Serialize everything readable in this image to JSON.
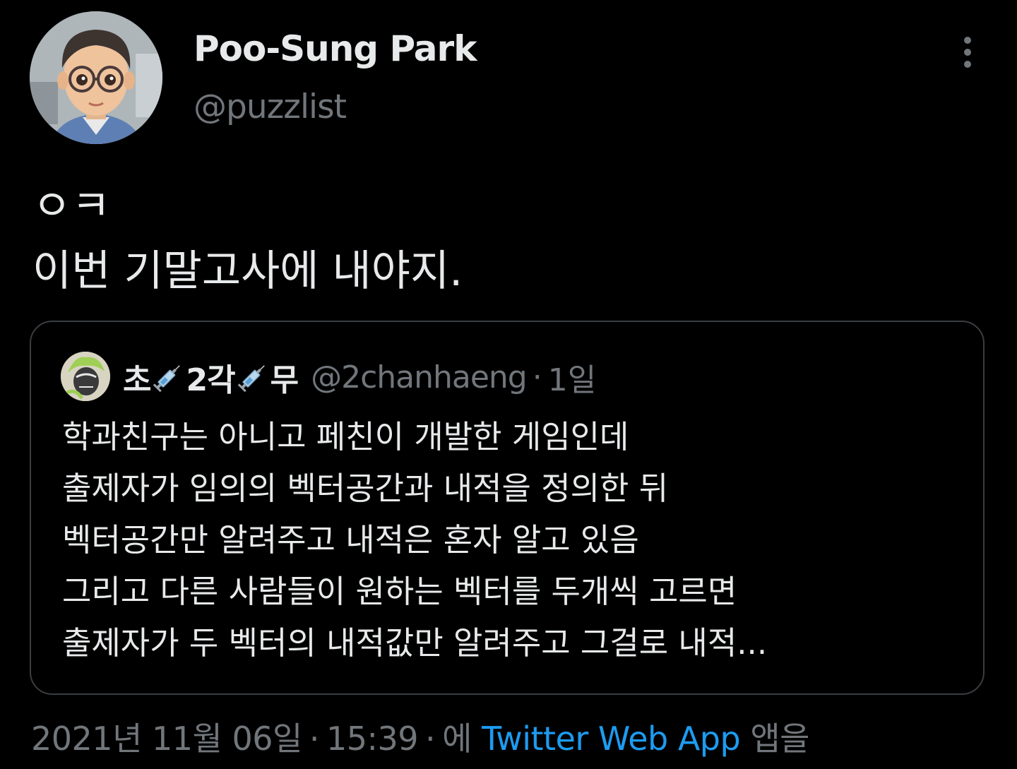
{
  "tweet": {
    "author": {
      "name": "Poo-Sung Park",
      "handle": "@puzzlist",
      "avatar": "avatar-icon"
    },
    "more_icon": "more-vertical-icon",
    "text_lines": [
      "ㅇㅋ",
      "이번 기말고사에 내야지."
    ],
    "quote": {
      "name_parts": [
        "초",
        "2각",
        "무"
      ],
      "name_emoji": "syringe-icon",
      "handle": "@2chanhaeng",
      "separator": "·",
      "time": "1일",
      "text_lines": [
        "학과친구는 아니고 페친이 개발한 게임인데",
        "출제자가 임의의 벡터공간과 내적을 정의한 뒤",
        "벡터공간만 알려주고 내적은 혼자 알고 있음",
        "그리고 다른 사람들이 원하는 벡터를 두개씩 고르면",
        "출제자가 두 벡터의 내적값만 알려주고 그걸로 내적..."
      ]
    },
    "meta": {
      "date": "2021년 11월 06일",
      "separator": "·",
      "time": "15:39",
      "via_prefix": "에",
      "source": "Twitter Web App",
      "via_suffix": "앱을"
    }
  },
  "colors": {
    "background": "#000000",
    "text_primary": "#e7e9ea",
    "text_secondary": "#71767b",
    "link": "#1d9bf0",
    "border": "#3a3d41"
  }
}
